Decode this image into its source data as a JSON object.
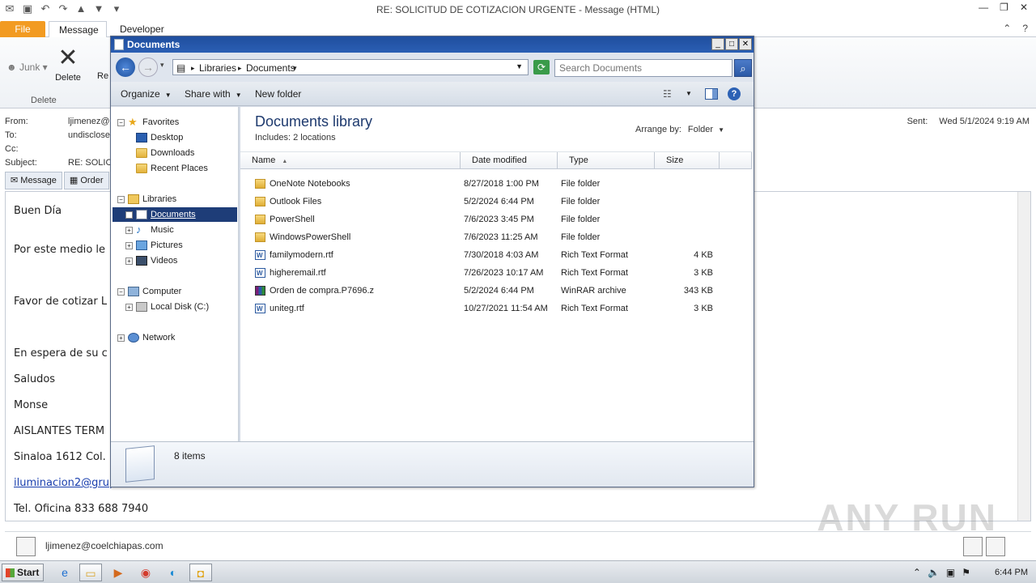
{
  "outlook": {
    "title": "RE: SOLICITUD DE COTIZACION URGENTE  -  Message (HTML)",
    "tabs": [
      "File",
      "Message",
      "Developer"
    ],
    "ribbon": {
      "junk_label": "Junk",
      "delete_label": "Delete",
      "reply_label": "Re",
      "group_label": "Delete"
    },
    "headers": {
      "from_label": "From:",
      "from_value": "ljimenez@c",
      "to_label": "To:",
      "to_value": "undisclose",
      "cc_label": "Cc:",
      "subject_label": "Subject:",
      "subject_value": "RE: SOLIC",
      "sent_label": "Sent:",
      "sent_value": "Wed 5/1/2024 9:19 AM"
    },
    "message_tabs": [
      "Message",
      "Order"
    ],
    "body_lines": [
      "Buen Día",
      "Por este medio le",
      "Favor de cotizar L",
      "En espera de su c",
      "Saludos",
      "Monse",
      "AISLANTES TERM",
      "Sinaloa 1612 Col.",
      "iluminacion2@grup",
      "Tel. Oficina 833 688 7940"
    ],
    "people_pane_email": "ljimenez@coelchiapas.com",
    "watermark": "ANY RUN"
  },
  "explorer": {
    "title": "Documents",
    "breadcrumb": [
      "Libraries",
      "Documents"
    ],
    "search_placeholder": "Search Documents",
    "toolbar": {
      "organize": "Organize",
      "share_with": "Share with",
      "new_folder": "New folder"
    },
    "nav": {
      "favorites": "Favorites",
      "desktop": "Desktop",
      "downloads": "Downloads",
      "recent_places": "Recent Places",
      "libraries": "Libraries",
      "documents": "Documents",
      "music": "Music",
      "pictures": "Pictures",
      "videos": "Videos",
      "computer": "Computer",
      "local_disk": "Local Disk (C:)",
      "network": "Network"
    },
    "library_title": "Documents library",
    "library_includes": "Includes:  2 locations",
    "arrange_label": "Arrange by:",
    "arrange_value": "Folder",
    "columns": {
      "name": "Name",
      "date": "Date modified",
      "type": "Type",
      "size": "Size"
    },
    "files": [
      {
        "name": "OneNote Notebooks",
        "date": "8/27/2018 1:00 PM",
        "type": "File folder",
        "size": "",
        "icon": "folder-icon"
      },
      {
        "name": "Outlook Files",
        "date": "5/2/2024 6:44 PM",
        "type": "File folder",
        "size": "",
        "icon": "folder-icon"
      },
      {
        "name": "PowerShell",
        "date": "7/6/2023 3:45 PM",
        "type": "File folder",
        "size": "",
        "icon": "folder-icon"
      },
      {
        "name": "WindowsPowerShell",
        "date": "7/6/2023 11:25 AM",
        "type": "File folder",
        "size": "",
        "icon": "folder-icon"
      },
      {
        "name": "familymodern.rtf",
        "date": "7/30/2018 4:03 AM",
        "type": "Rich Text Format",
        "size": "4 KB",
        "icon": "rtf-file-icon"
      },
      {
        "name": "higheremail.rtf",
        "date": "7/26/2023 10:17 AM",
        "type": "Rich Text Format",
        "size": "3 KB",
        "icon": "rtf-file-icon"
      },
      {
        "name": "Orden de compra.P7696.z",
        "date": "5/2/2024 6:44 PM",
        "type": "WinRAR archive",
        "size": "343 KB",
        "icon": "winrar-archive-icon"
      },
      {
        "name": "uniteg.rtf",
        "date": "10/27/2021 11:54 AM",
        "type": "Rich Text Format",
        "size": "3 KB",
        "icon": "rtf-file-icon"
      }
    ],
    "item_count": "8 items"
  },
  "taskbar": {
    "start_label": "Start",
    "clock": "6:44 PM"
  }
}
